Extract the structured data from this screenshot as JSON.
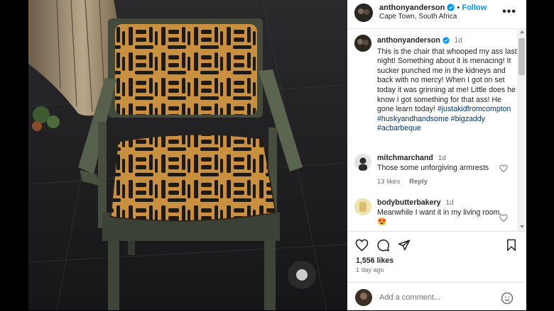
{
  "post": {
    "username": "anthonyanderson",
    "follow_label": "Follow",
    "location": "Cape Town, South Africa",
    "more_label": "•••"
  },
  "caption": {
    "username": "anthonyanderson",
    "time": "1d",
    "text": "This is the chair that whooped my ass last night! Something about it is menacing! It sucker punched me in the kidneys and back with no mercy! When I got on set today it was grinning at me! Little does he know I got something for that ass! He gone learn today! ",
    "hashtags": [
      "#justakidfromcompton",
      "#huskyandhandsome",
      "#bigzaddy",
      "#acbarbeque"
    ]
  },
  "comments": [
    {
      "username": "mitchmarchand",
      "time": "1d",
      "text": "Those some unforgiving armrests",
      "likes": "13 likes",
      "reply": "Reply"
    },
    {
      "username": "bodybutterbakery",
      "time": "1d",
      "text": "Meanwhile I want it in my living room. 😍",
      "likes": "",
      "reply": ""
    }
  ],
  "stats": {
    "likes": "1,556 likes",
    "ago": "1 day ago"
  },
  "add_comment": {
    "placeholder": "Add a comment..."
  },
  "icons": [
    "verified-badge-icon",
    "more-icon",
    "heart-icon",
    "comment-icon",
    "share-icon",
    "bookmark-icon",
    "emoji-icon"
  ],
  "colors": {
    "accent": "#0095f6",
    "hashtag": "#00376b",
    "chair_fabric": "#c8903f",
    "chair_frame": "#4a5040"
  }
}
